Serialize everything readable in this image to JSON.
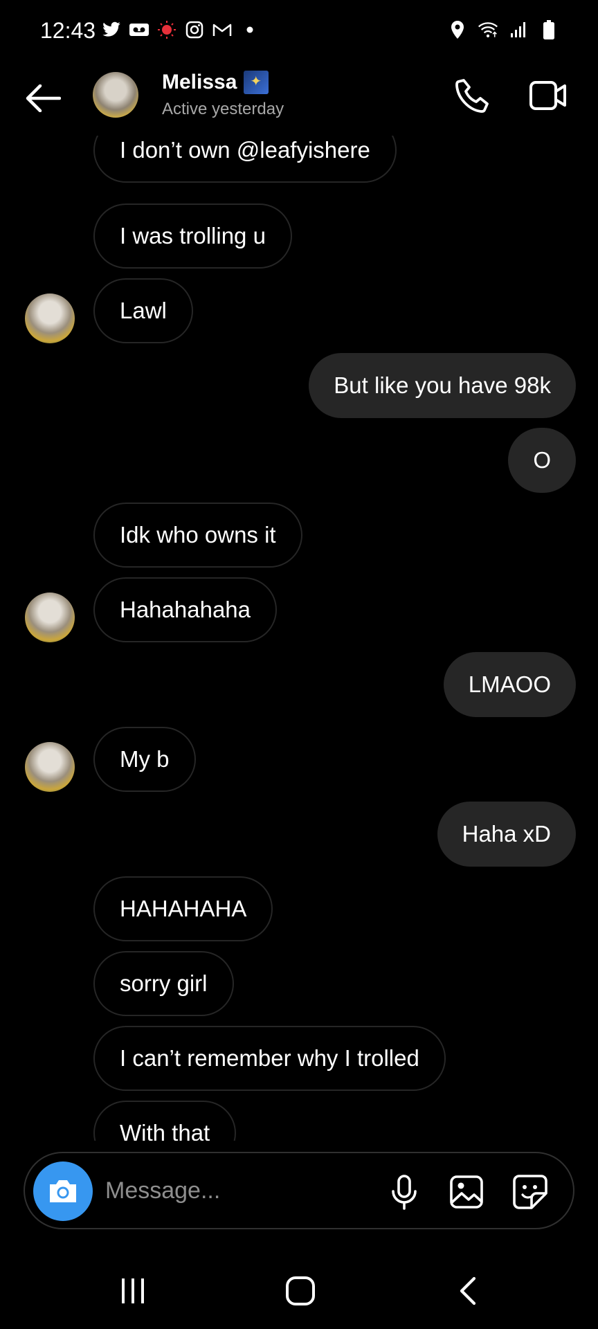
{
  "status_bar": {
    "time": "12:43",
    "left_icons": [
      "twitter-icon",
      "voicemail-icon",
      "recording-icon",
      "instagram-icon",
      "gmail-icon",
      "dot-icon"
    ],
    "right_icons": [
      "location-icon",
      "wifi-icon",
      "signal-icon",
      "battery-icon"
    ]
  },
  "header": {
    "contact_name": "Melissa",
    "status": "Active yesterday"
  },
  "messages": [
    {
      "side": "in",
      "text": "I don’t own @leafyishere",
      "avatar": false
    },
    {
      "side": "in",
      "text": "I was trolling u",
      "avatar": false
    },
    {
      "side": "in",
      "text": "Lawl",
      "avatar": true
    },
    {
      "side": "out",
      "text": "But like you have 98k"
    },
    {
      "side": "out",
      "text": "O"
    },
    {
      "side": "in",
      "text": "Idk who owns it",
      "avatar": false
    },
    {
      "side": "in",
      "text": "Hahahahaha",
      "avatar": true
    },
    {
      "side": "out",
      "text": "LMAOO"
    },
    {
      "side": "in",
      "text": "My b",
      "avatar": true
    },
    {
      "side": "out",
      "text": "Haha xD"
    },
    {
      "side": "in",
      "text": "HAHAHAHA",
      "avatar": false
    },
    {
      "side": "in",
      "text": "sorry girl",
      "avatar": false
    },
    {
      "side": "in",
      "text": "I can’t remember why I trolled",
      "avatar": false
    },
    {
      "side": "in",
      "text": "With that",
      "avatar": false
    }
  ],
  "composer": {
    "placeholder": "Message...",
    "accent_color": "#3797f0"
  },
  "colors": {
    "background": "#000000",
    "outgoing_bubble": "#262626",
    "incoming_border": "#262626",
    "secondary_text": "#a8a8a8"
  }
}
